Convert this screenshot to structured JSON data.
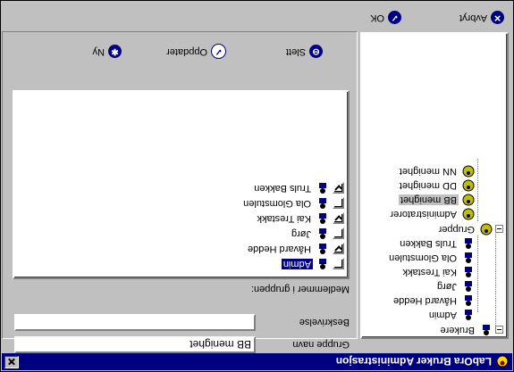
{
  "window": {
    "title": "LabOra Bruker Administrasjon"
  },
  "actions": {
    "ok_label": "OK",
    "cancel_label": "Avbryt"
  },
  "toolbar": {
    "new_label": "Ny",
    "update_label": "Oppdater",
    "delete_label": "Slett"
  },
  "tree": {
    "users_node": "Brukere",
    "users": [
      "Admin",
      "Håvard Hedde",
      "Jørg",
      "Kai Trestakk",
      "Ola Glomstulen",
      "Truls Bakken"
    ],
    "groups_node": "Grupper",
    "groups": [
      "Administratorer",
      "BB menighet",
      "DD menighet",
      "NN menighet"
    ],
    "selected_group": "BB menighet"
  },
  "form": {
    "group_name_label": "Gruppe navn",
    "group_name_value": "BB menighet",
    "description_label": "Beskrivelse",
    "description_value": "",
    "members_label": "Medlemmer i gruppen:"
  },
  "members": [
    {
      "name": "Admin",
      "checked": false,
      "selected": true
    },
    {
      "name": "Håvard Hedde",
      "checked": true,
      "selected": false
    },
    {
      "name": "Jørg",
      "checked": false,
      "selected": false
    },
    {
      "name": "Kai Trestakk",
      "checked": true,
      "selected": false
    },
    {
      "name": "Ola Glomstulen",
      "checked": false,
      "selected": false
    },
    {
      "name": "Truls Bakken",
      "checked": true,
      "selected": false
    }
  ],
  "icons": {
    "user": "user-icon",
    "group": "group-icon",
    "app": "app-icon"
  },
  "colors": {
    "titlebar": "#000080",
    "face": "#c0c0c0",
    "selection": "#000080"
  }
}
